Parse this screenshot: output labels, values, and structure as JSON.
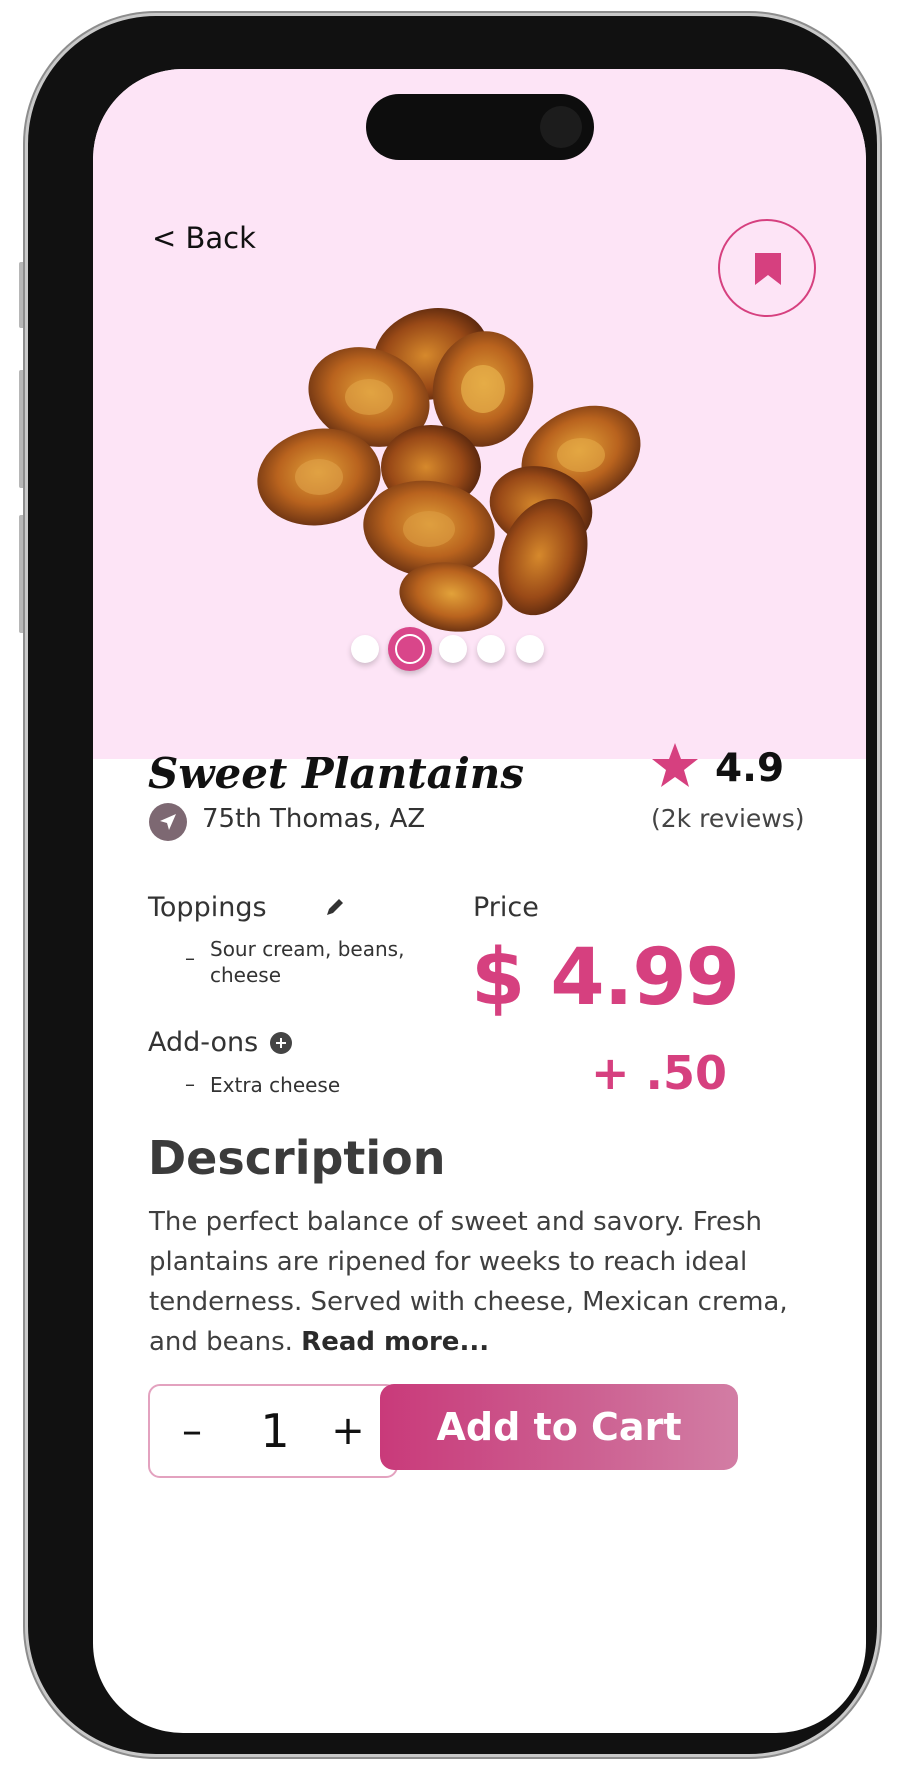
{
  "nav": {
    "back_label": "< Back"
  },
  "carousel": {
    "count": 5,
    "active_index": 1
  },
  "product": {
    "name": "Sweet Plantains",
    "location": "75th Thomas, AZ",
    "rating": "4.9",
    "reviews": "(2k reviews)"
  },
  "toppings": {
    "label": "Toppings",
    "items": [
      "Sour cream, beans,",
      "cheese"
    ]
  },
  "addons": {
    "label": "Add-ons",
    "item": "Extra cheese"
  },
  "price": {
    "label": "Price",
    "value": "$ 4.99",
    "addon": "+ .50"
  },
  "description": {
    "heading": "Description",
    "text": "The perfect balance of sweet and savory. Fresh plantains are ripened for weeks to reach ideal tenderness. Served with cheese, Mexican crema, and beans.",
    "read_more": "Read more..."
  },
  "quantity": {
    "minus": "–",
    "value": "1",
    "plus": "+"
  },
  "cart_button": "Add to Cart",
  "colors": {
    "accent": "#d6407f",
    "hero_bg": "#fde4f6",
    "cart_start": "#c93a7a",
    "cart_end": "#d27da4"
  },
  "icons": [
    "bookmark-icon",
    "location-arrow-icon",
    "star-icon",
    "pencil-icon",
    "plus-circle-icon"
  ]
}
